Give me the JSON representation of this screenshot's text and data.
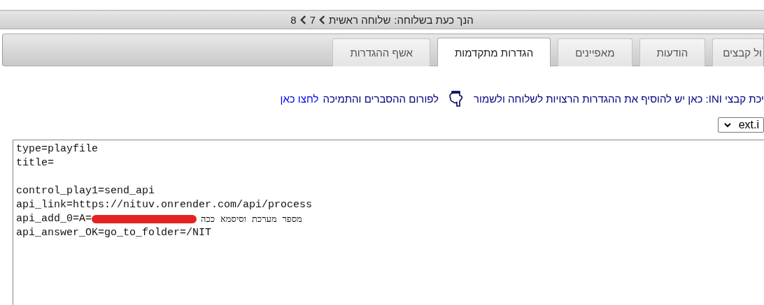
{
  "breadcrumb": {
    "prefix": "הנך כעת בשלוחה:",
    "items": [
      "שלוחה ראשית",
      "7",
      "8"
    ]
  },
  "tabs": [
    {
      "label": "ול קבצים",
      "selected": false
    },
    {
      "label": "הודעות",
      "selected": false
    },
    {
      "label": "מאפיינים",
      "selected": false
    },
    {
      "label": "הגדרות מתקדמות",
      "selected": true
    },
    {
      "label": "אשף ההגדרות",
      "selected": false
    }
  ],
  "info": {
    "text": "יכת קבצי INI: כאן יש להוסיף את ההגדרות הרצויות לשלוחה ולשמור",
    "forum": "לפורום ההסברים והתמיכה",
    "link": "לחצו כאן"
  },
  "file_select": {
    "value": "ext.i"
  },
  "editor": {
    "blocks": [
      [
        {
          "text": "type=playfile"
        },
        {
          "text": "title="
        }
      ],
      [
        {
          "text": "control_play1=send_api"
        },
        {
          "text": "api_link=https://nituv.onrender.com/api/process"
        },
        {
          "text": "api_add_0=A=",
          "redacted": true,
          "after": "מספר מערכת וסיסמא ככה"
        },
        {
          "text": "api_answer_OK=go_to_folder=/NIT"
        }
      ]
    ]
  }
}
